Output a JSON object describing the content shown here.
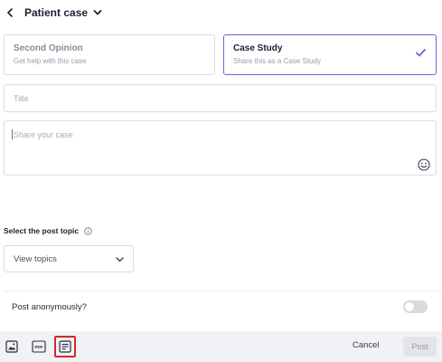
{
  "header": {
    "title": "Patient case",
    "back_icon": "chevron-left-icon",
    "dropdown_icon": "chevron-down-icon"
  },
  "post_types": [
    {
      "title": "Second Opinion",
      "subtitle": "Get help with this case",
      "selected": false
    },
    {
      "title": "Case Study",
      "subtitle": "Share this as a Case Study",
      "selected": true
    }
  ],
  "form": {
    "title_placeholder": "Title",
    "title_value": "",
    "case_placeholder": "Share your case",
    "case_value": ""
  },
  "topic": {
    "label": "Select the post topic",
    "select_label": "View topics"
  },
  "anonymous": {
    "label": "Post anonymously?",
    "enabled": false
  },
  "footer": {
    "cancel_label": "Cancel",
    "post_label": "Post",
    "icons": [
      "image-icon",
      "pdf-icon",
      "document-icon"
    ]
  },
  "colors": {
    "accent": "#7c5ad6",
    "highlight_border": "#d62828",
    "footer_bg": "#f0f2f6"
  }
}
